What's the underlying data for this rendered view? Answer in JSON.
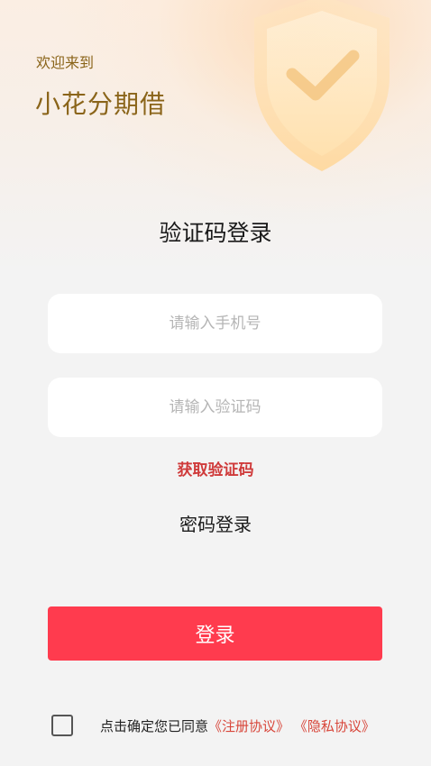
{
  "header": {
    "welcome": "欢迎来到",
    "app_name": "小花分期借"
  },
  "login": {
    "title": "验证码登录",
    "phone_placeholder": "请输入手机号",
    "code_placeholder": "请输入验证码",
    "get_code": "获取验证码",
    "password_login": "密码登录",
    "submit": "登录"
  },
  "agreement": {
    "checked": false,
    "text": "点击确定您已同意",
    "register_link": "《注册协议》",
    "privacy_link": "《隐私协议》"
  },
  "icons": {
    "shield": "shield-check-icon"
  },
  "colors": {
    "brand_gold": "#8a6419",
    "primary_red": "#ff3b4e",
    "link_red": "#d8463a",
    "get_code_red": "#cf3a3a"
  }
}
